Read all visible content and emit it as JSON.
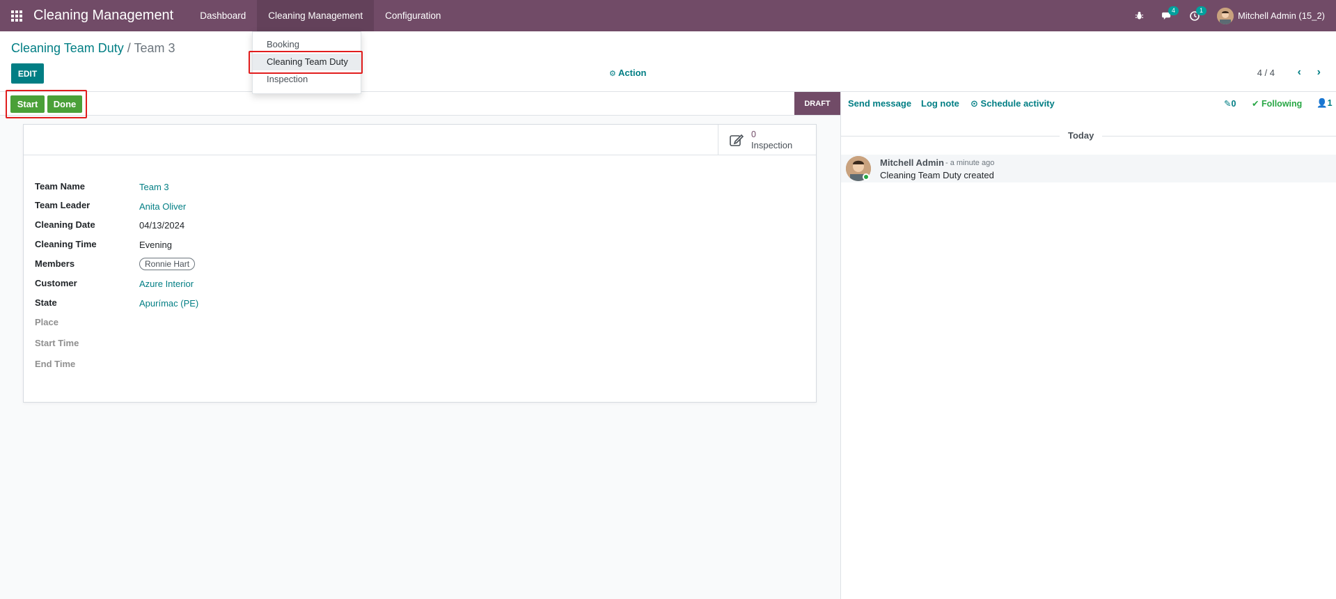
{
  "navbar": {
    "brand": "Cleaning Management",
    "menu": [
      "Dashboard",
      "Cleaning Management",
      "Configuration"
    ],
    "messages_count": "4",
    "activities_count": "1",
    "user": "Mitchell Admin (15_2)"
  },
  "dropdown": {
    "items": [
      "Booking",
      "Cleaning Team Duty",
      "Inspection"
    ]
  },
  "control": {
    "breadcrumb_parent": "Cleaning Team Duty",
    "breadcrumb_sep": "/",
    "breadcrumb_current": "Team 3",
    "edit_label": "EDIT",
    "action_label": "Action",
    "pager": "4 / 4"
  },
  "statusbar": {
    "start_label": "Start",
    "done_label": "Done",
    "state": "DRAFT"
  },
  "smart_button": {
    "value": "0",
    "label": "Inspection"
  },
  "form": {
    "team_name_label": "Team Name",
    "team_name": "Team 3",
    "team_leader_label": "Team Leader",
    "team_leader": "Anita Oliver",
    "cleaning_date_label": "Cleaning Date",
    "cleaning_date": "04/13/2024",
    "cleaning_time_label": "Cleaning Time",
    "cleaning_time": "Evening",
    "members_label": "Members",
    "members": [
      "Ronnie Hart"
    ],
    "customer_label": "Customer",
    "customer": "Azure Interior",
    "state_label": "State",
    "state": "Apurímac (PE)",
    "place_label": "Place",
    "start_time_label": "Start Time",
    "end_time_label": "End Time"
  },
  "chatter": {
    "send_message": "Send message",
    "log_note": "Log note",
    "schedule_activity": "Schedule activity",
    "attachments": "0",
    "following": "Following",
    "followers": "1",
    "today": "Today",
    "message": {
      "author": "Mitchell Admin",
      "date": "- a minute ago",
      "body": "Cleaning Team Duty created"
    }
  },
  "colors": {
    "primary": "#714b67",
    "accent": "#017e84",
    "success": "#4aa038",
    "highlight": "#e11d1d"
  }
}
